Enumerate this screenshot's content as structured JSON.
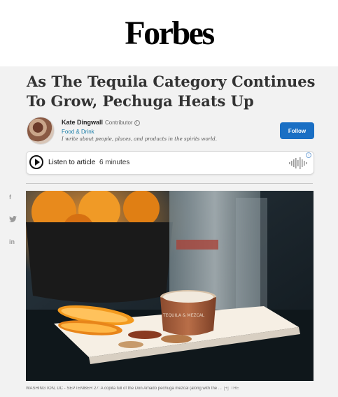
{
  "masthead": {
    "logo": "Forbes"
  },
  "article": {
    "headline": "As The Tequila Category Continues To Grow, Pechuga Heats Up",
    "author": {
      "name": "Kate Dingwall",
      "role": "Contributor",
      "section": "Food & Drink",
      "bio": "I write about people, places, and products in the spirits world."
    },
    "follow_label": "Follow",
    "audio": {
      "label": "Listen to article",
      "duration": "6 minutes"
    },
    "photo": {
      "cup_text": "TEQUILA & MEZCAL"
    },
    "caption": "WASHINGTON, DC - SEPTEMBER 27: A copita full of the Don Amado pechuga mezcal (along with the ...",
    "caption_more": "[+]",
    "caption_credit": "THE"
  },
  "share": {
    "icons": [
      "facebook-icon",
      "twitter-icon",
      "linkedin-icon"
    ],
    "facebook": "f",
    "linkedin": "in"
  },
  "colors": {
    "follow": "#1a6fc4",
    "section_link": "#1a7ea8",
    "page_bg": "#f2f2f2"
  }
}
